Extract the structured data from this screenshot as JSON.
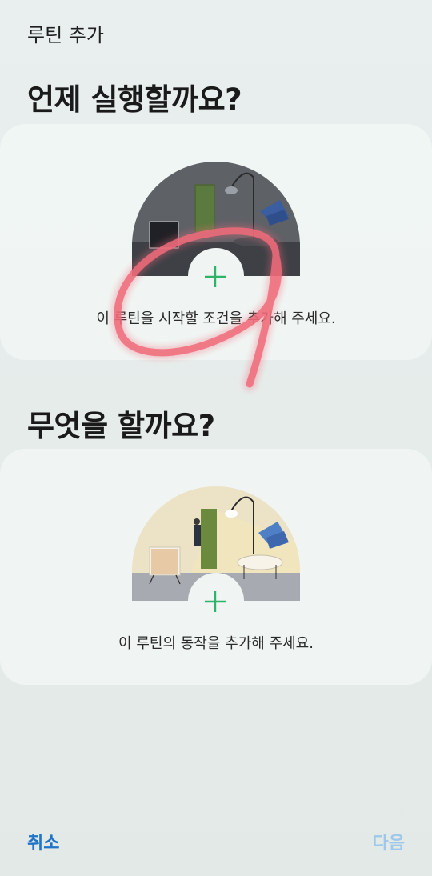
{
  "header": {
    "title": "루틴 추가"
  },
  "when_section": {
    "heading": "언제 실행할까요?",
    "caption": "이 루틴을 시작할 조건을 추가해 주세요.",
    "add_icon": "plus-icon"
  },
  "what_section": {
    "heading": "무엇을 할까요?",
    "caption": "이 루틴의 동작을 추가해 주세요.",
    "add_icon": "plus-icon"
  },
  "footer": {
    "cancel_label": "취소",
    "next_label": "다음"
  },
  "colors": {
    "accent": "#1f74c9",
    "disabled": "#9ec7e9",
    "plus": "#2fb36a",
    "scribble": "#f06b7a"
  }
}
